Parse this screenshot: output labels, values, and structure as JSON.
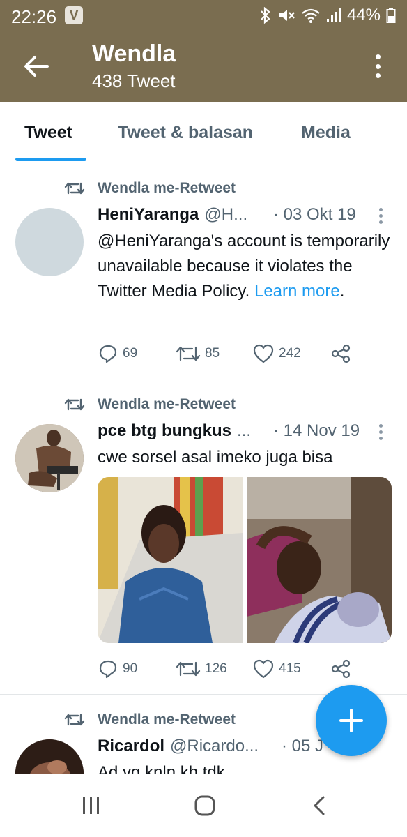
{
  "status_bar": {
    "time": "22:26",
    "app_badge": "V",
    "battery": "44%",
    "icons": [
      "bluetooth-icon",
      "mute-icon",
      "wifi-icon",
      "signal-icon",
      "battery-icon"
    ]
  },
  "header": {
    "title": "Wendla",
    "subtitle": "438 Tweet"
  },
  "tabs": [
    {
      "label": "Tweet",
      "active": true
    },
    {
      "label": "Tweet & balasan",
      "active": false
    },
    {
      "label": "Media",
      "active": false
    }
  ],
  "tweets": [
    {
      "retweet_label": "Wendla me-Retweet",
      "name": "HeniYaranga",
      "handle": "@H...",
      "date": "· 03 Okt 19",
      "text": "@HeniYaranga's account is temporarily unavailable because it violates the Twitter Media Policy.",
      "link": "Learn more",
      "link_suffix": ".",
      "replies": "69",
      "retweets": "85",
      "likes": "242"
    },
    {
      "retweet_label": "Wendla me-Retweet",
      "name": "pce btg bungkus",
      "handle": "...",
      "date": "· 14 Nov 19",
      "text": "cwe sorsel asal imeko juga bisa",
      "replies": "90",
      "retweets": "126",
      "likes": "415"
    },
    {
      "retweet_label": "Wendla me-Retweet",
      "name": "Ricardol",
      "handle": "@Ricardo...",
      "date": "· 05 J",
      "text": "Ad yg knln kh tdk"
    }
  ],
  "colors": {
    "header_bg": "#7a6d50",
    "accent": "#1d9bf0",
    "muted": "#536471"
  }
}
